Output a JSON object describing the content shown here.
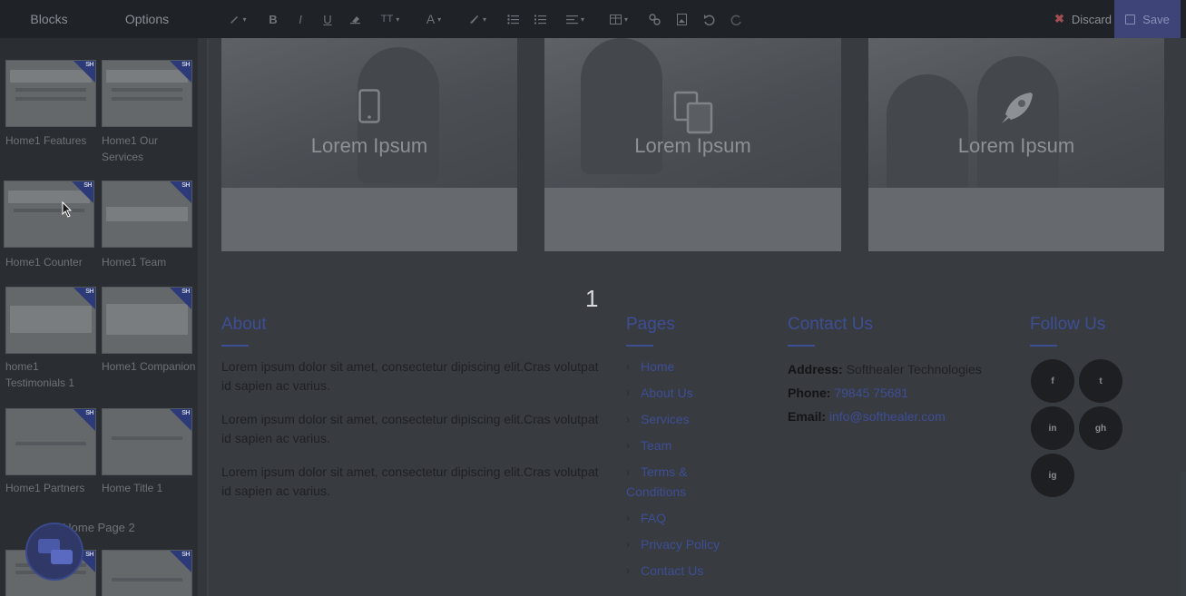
{
  "toolbar": {
    "tab_blocks": "Blocks",
    "tab_options": "Options",
    "discard_label": "Discard",
    "save_label": "Save"
  },
  "panel": {
    "thumbs": [
      {
        "label": "Home1 Features"
      },
      {
        "label": "Home1 Our Services"
      },
      {
        "label": "Home1 Counter"
      },
      {
        "label": "Home1 Team"
      },
      {
        "label": "home1 Testimonials 1"
      },
      {
        "label": "Home1 Companion"
      },
      {
        "label": "Home1 Partners"
      },
      {
        "label": "Home Title 1"
      }
    ],
    "badge": "SH",
    "section_title": "Home Page 2"
  },
  "cards": [
    {
      "title": "Lorem Ipsum",
      "icon": "mobile-icon"
    },
    {
      "title": "Lorem Ipsum",
      "icon": "files-icon"
    },
    {
      "title": "Lorem Ipsum",
      "icon": "rocket-icon"
    }
  ],
  "pager": "1",
  "footer": {
    "about": {
      "title": "About",
      "paragraphs": [
        "Lorem ipsum dolor sit amet, consectetur dipiscing elit.Cras volutpat id sapien ac varius.",
        "Lorem ipsum dolor sit amet, consectetur dipiscing elit.Cras volutpat id sapien ac varius.",
        "Lorem ipsum dolor sit amet, consectetur dipiscing elit.Cras volutpat id sapien ac varius."
      ]
    },
    "pages": {
      "title": "Pages",
      "items": [
        "Home",
        "About Us",
        "Services",
        "Team",
        "Terms & Conditions",
        "FAQ",
        "Privacy Policy",
        "Contact Us"
      ]
    },
    "contact": {
      "title": "Contact Us",
      "address_label": "Address:",
      "address_value": "Softhealer Technologies",
      "phone_label": "Phone:",
      "phone_value": "79845 75681",
      "email_label": "Email:",
      "email_value": "info@softhealer.com"
    },
    "follow": {
      "title": "Follow Us",
      "networks": [
        {
          "name": "facebook-icon",
          "glyph": "f"
        },
        {
          "name": "twitter-icon",
          "glyph": "t"
        },
        {
          "name": "linkedin-icon",
          "glyph": "in"
        },
        {
          "name": "github-icon",
          "glyph": "gh"
        },
        {
          "name": "instagram-icon",
          "glyph": "ig"
        }
      ]
    }
  },
  "colors": {
    "accent": "#3e4e95",
    "toolbar_bg": "#1f2227",
    "save_bg": "#3e4477",
    "discard_icon": "#a34d52"
  }
}
